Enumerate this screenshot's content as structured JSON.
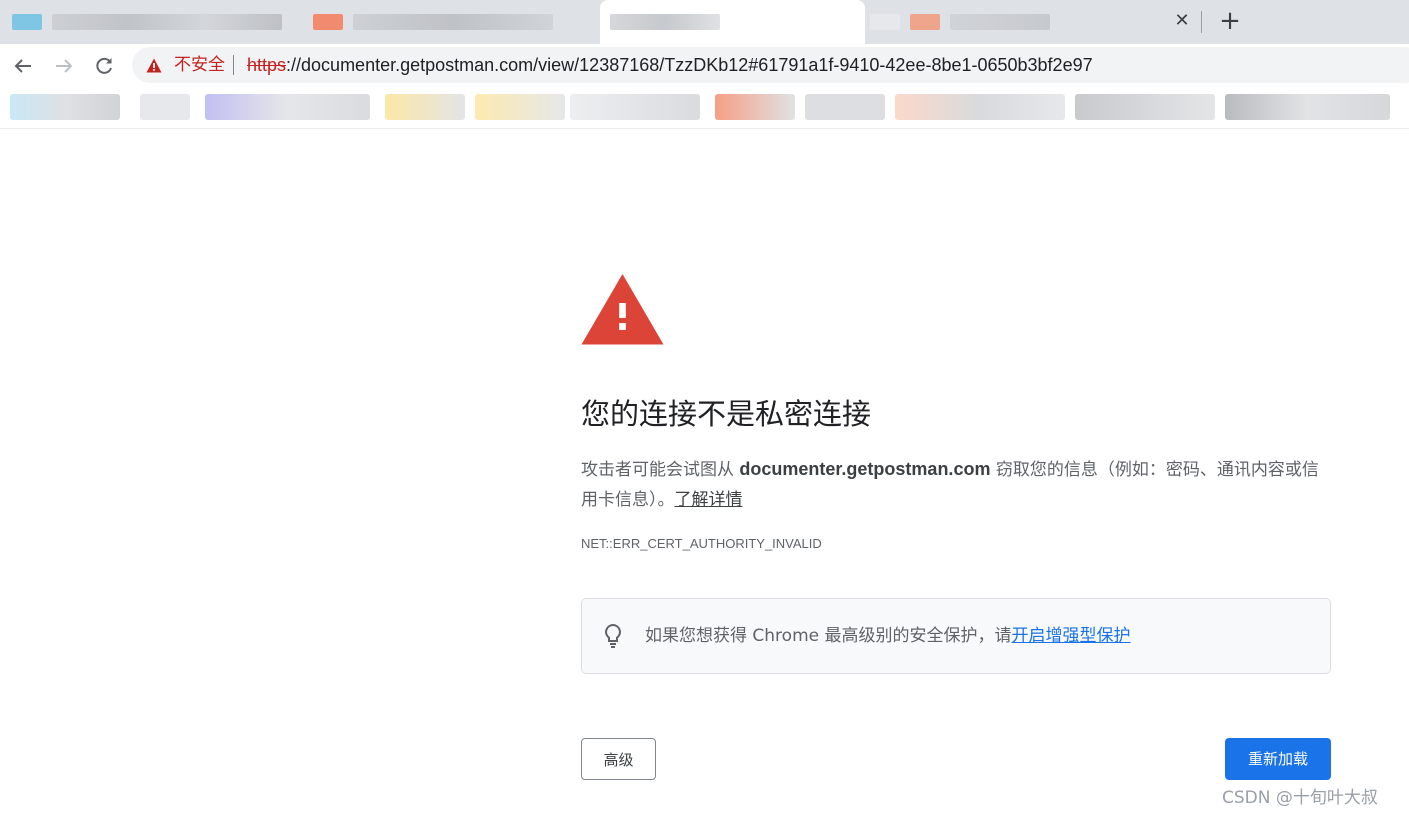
{
  "browser": {
    "tab_close_glyph": "✕",
    "new_tab_glyph": "+",
    "security_label": "不安全",
    "url_scheme": "https",
    "url_rest": "://documenter.getpostman.com/view/12387168/TzzDKb12#61791a1f-9410-42ee-8be1-0650b3bf2e97"
  },
  "interstitial": {
    "heading": "您的连接不是私密连接",
    "explanation_prefix": "攻击者可能会试图从 ",
    "explanation_host": "documenter.getpostman.com",
    "explanation_suffix": " 窃取您的信息（例如：密码、通讯内容或信用卡信息）。",
    "learn_more_link": "了解详情",
    "error_code": "NET::ERR_CERT_AUTHORITY_INVALID",
    "promo_text": "如果您想获得 Chrome 最高级别的安全保护，请",
    "promo_link": "开启增强型保护",
    "advanced_button": "高级",
    "reload_button": "重新加载"
  },
  "watermark": "CSDN @十旬叶大叔",
  "colors": {
    "danger": "#db4437",
    "primary_button": "#1a73e8",
    "insecure_text": "#c5221f"
  },
  "icons": [
    "back-arrow-icon",
    "forward-arrow-icon",
    "reload-icon",
    "warning-triangle-icon",
    "lightbulb-icon"
  ]
}
